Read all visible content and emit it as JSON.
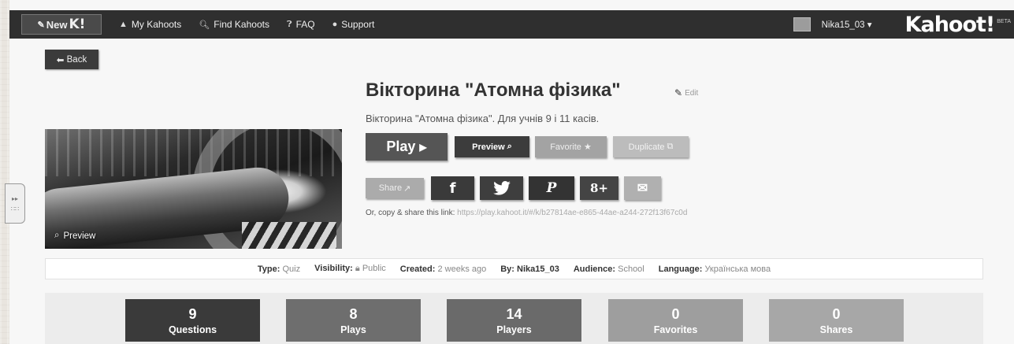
{
  "nav": {
    "new_label": "New",
    "new_k": "K!",
    "items": [
      {
        "label": "My Kahoots",
        "icon": "user-icon"
      },
      {
        "label": "Find Kahoots",
        "icon": "search-icon"
      },
      {
        "label": "FAQ",
        "icon": "question-icon"
      },
      {
        "label": "Support",
        "icon": "chat-icon"
      }
    ],
    "user_name": "Nika15_03",
    "logo": "Kahoot!",
    "beta": "BETA"
  },
  "back_label": "Back",
  "quiz": {
    "title": "Вікторина \"Атомна фізика\"",
    "edit_label": "Edit",
    "description": "Вікторина \"Атомна фізика\". Для учнів 9 і 11 касів.",
    "cover_preview_label": "Preview"
  },
  "actions": {
    "play": "Play",
    "preview": "Preview",
    "favorite": "Favorite",
    "duplicate": "Duplicate"
  },
  "share": {
    "share_label": "Share",
    "facebook": "f",
    "google_plus": "8+",
    "pinterest": "P",
    "link_prefix": "Or, copy & share this link:",
    "link_url": "https://play.kahoot.it/#/k/b27814ae-e865-44ae-a244-272f13f67c0d"
  },
  "info": {
    "type_label": "Type:",
    "type": "Quiz",
    "visibility_label": "Visibility:",
    "visibility": "Public",
    "created_label": "Created:",
    "created": "2 weeks ago",
    "by_label": "By:",
    "by": "Nika15_03",
    "audience_label": "Audience:",
    "audience": "School",
    "language_label": "Language:",
    "language": "Українська мова"
  },
  "stats": [
    {
      "value": "9",
      "label": "Questions"
    },
    {
      "value": "8",
      "label": "Plays"
    },
    {
      "value": "14",
      "label": "Players"
    },
    {
      "value": "0",
      "label": "Favorites"
    },
    {
      "value": "0",
      "label": "Shares"
    }
  ]
}
